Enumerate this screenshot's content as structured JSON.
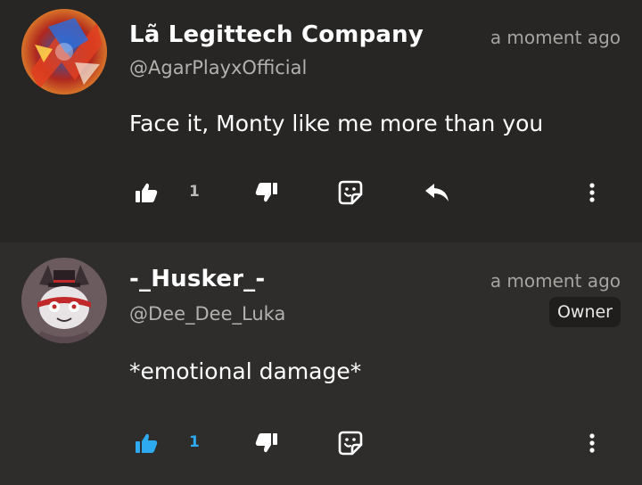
{
  "comments": [
    {
      "author": "Lã Legittech Company",
      "handle": "@AgarPlayxOfficial",
      "time": "a moment ago",
      "text": "Face it, Monty like me more than you",
      "likes": "1",
      "liked": false,
      "has_reply": true,
      "avatar_icon": "avatar-fiery-art-icon"
    },
    {
      "author": "-_Husker_-",
      "handle": "@Dee_Dee_Luka",
      "time": "a moment ago",
      "badge": "Owner",
      "text": "*emotional damage*",
      "likes": "1",
      "liked": true,
      "has_reply": false,
      "avatar_icon": "avatar-cartoon-cat-icon"
    }
  ],
  "colors": {
    "like_active": "#2eaaf0",
    "icon_default": "#ffffff",
    "muted_text": "#a6a3a0"
  },
  "icons": {
    "like": "thumbs-up-icon",
    "dislike": "thumbs-down-icon",
    "sticker": "sticker-face-icon",
    "reply": "reply-arrow-icon",
    "more": "more-vertical-icon"
  }
}
